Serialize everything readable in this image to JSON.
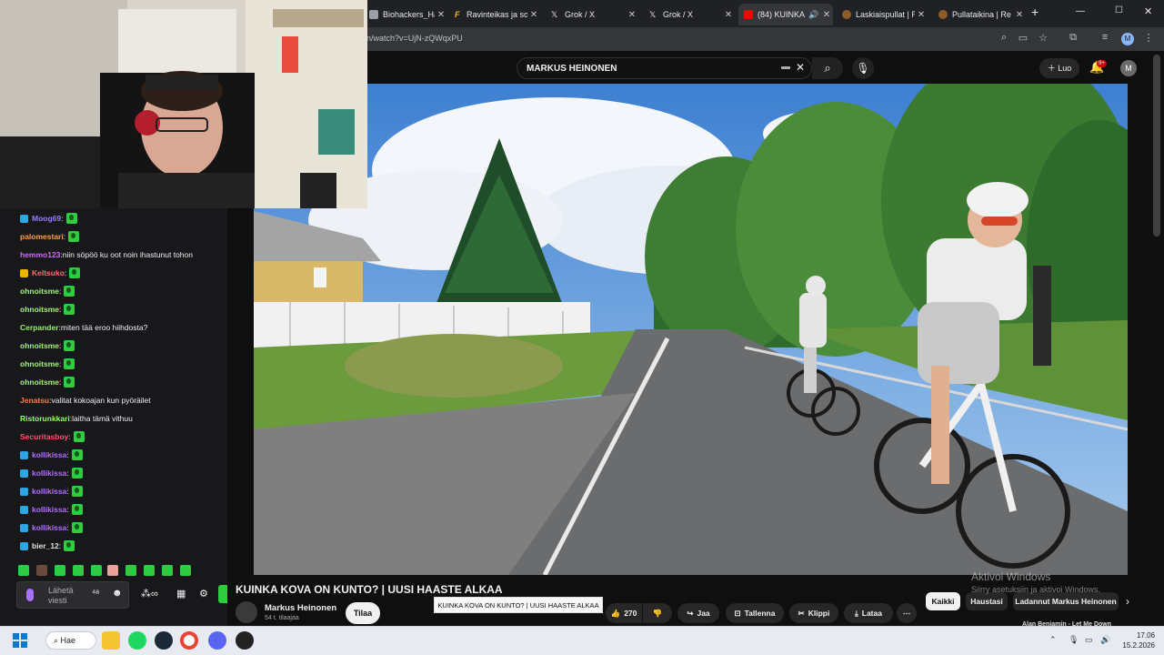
{
  "tabs": [
    {
      "title": "Biohackers_Hand",
      "favicon": "#9aa0a6"
    },
    {
      "title": "Ravinteikas ja so",
      "favicon": "#fbbc04"
    },
    {
      "title": "Grok / X",
      "favicon": "#e8eaed"
    },
    {
      "title": "Grok / X",
      "favicon": "#e8eaed"
    },
    {
      "title": "(84) KUINKA",
      "favicon": "#ff0000"
    },
    {
      "title": "Laskiaispullat | R",
      "favicon": "#8d5a2b"
    },
    {
      "title": "Pullataikina | Re",
      "favicon": "#8d5a2b"
    }
  ],
  "browser": {
    "url": "n/watch?v=UjN-zQWqxPU",
    "new_tab": "+",
    "minimize": "—",
    "maximize": "☐",
    "close": "✕",
    "profile": "M"
  },
  "youtube": {
    "search_value": "MARKUS HEINONEN",
    "create_label": "Luo",
    "notif_badge": "9+",
    "avatar_letter": "M",
    "video_title": "KUINKA KOVA ON KUNTO? | UUSI HAASTE ALKAA",
    "tooltip": "KUINKA KOVA ON KUNTO? | UUSI HAASTE ALKAA",
    "channel_name": "Markus Heinonen",
    "subscribers": "54 t. tilaajaa",
    "subscribe_label": "Tilaa",
    "likes": "270",
    "share_label": "Jaa",
    "save_label": "Tallenna",
    "clip_label": "Klippi",
    "download_label": "Lataa",
    "chips": [
      "Kaikki",
      "Haustasi",
      "Ladannut Markus Heinonen"
    ],
    "next_video": "Alan Benjamin - Let Me Down",
    "activate_title": "Aktivoi Windows",
    "activate_sub": "Siirry asetuksiin ja aktivoi Windows."
  },
  "chat": {
    "messages": [
      {
        "user": "Moog69",
        "color": "#9b7cff",
        "text": "",
        "emote": true,
        "badge": "#2ea6e6"
      },
      {
        "user": "palomestari",
        "color": "#ff9d3b",
        "text": "",
        "emote": true,
        "badge": ""
      },
      {
        "user": "hemmo123",
        "color": "#d169ff",
        "text": "niin söpöö ku oot noin ihastunut tohon",
        "emote": false,
        "badge": ""
      },
      {
        "user": "Keltsuko",
        "color": "#ff6b6b",
        "text": "",
        "emote": true,
        "badge": "#f0b400"
      },
      {
        "user": "ohnoitsme",
        "color": "#a3f07a",
        "text": "",
        "emote": true,
        "badge": ""
      },
      {
        "user": "ohnoitsme",
        "color": "#a3f07a",
        "text": "",
        "emote": true,
        "badge": ""
      },
      {
        "user": "Cerpander",
        "color": "#9bf06a",
        "text": "miten tää eroo hiihdosta?",
        "emote": false,
        "badge": ""
      },
      {
        "user": "ohnoitsme",
        "color": "#a3f07a",
        "text": "",
        "emote": true,
        "badge": ""
      },
      {
        "user": "ohnoitsme",
        "color": "#a3f07a",
        "text": "",
        "emote": true,
        "badge": ""
      },
      {
        "user": "ohnoitsme",
        "color": "#a3f07a",
        "text": "",
        "emote": true,
        "badge": ""
      },
      {
        "user": "Jenatsu",
        "color": "#ff7a3d",
        "text": "valitat kokoajan kun pyöräilet",
        "emote": false,
        "badge": ""
      },
      {
        "user": "Ristorunkkari",
        "color": "#8dff6a",
        "text": "laitha tämä vithuu",
        "emote": false,
        "badge": ""
      },
      {
        "user": "Securitasboy",
        "color": "#ff4f6d",
        "text": "",
        "emote": true,
        "badge": ""
      },
      {
        "user": "kollikissa",
        "color": "#b36cff",
        "text": "",
        "emote": true,
        "badge": "#2ea6e6"
      },
      {
        "user": "kollikissa",
        "color": "#b36cff",
        "text": "",
        "emote": true,
        "badge": "#2ea6e6"
      },
      {
        "user": "kollikissa",
        "color": "#b36cff",
        "text": "",
        "emote": true,
        "badge": "#2ea6e6"
      },
      {
        "user": "kollikissa",
        "color": "#b36cff",
        "text": "",
        "emote": true,
        "badge": "#2ea6e6"
      },
      {
        "user": "kollikissa",
        "color": "#b36cff",
        "text": "",
        "emote": true,
        "badge": "#2ea6e6"
      },
      {
        "user": "bier_12",
        "color": "#e0e0e0",
        "text": "",
        "emote": true,
        "badge": "#2ea6e6"
      }
    ],
    "input_placeholder": "Lähetä viesti"
  },
  "taskbar": {
    "search_label": "Hae",
    "time": "17.06",
    "date": "15.2.2026"
  }
}
